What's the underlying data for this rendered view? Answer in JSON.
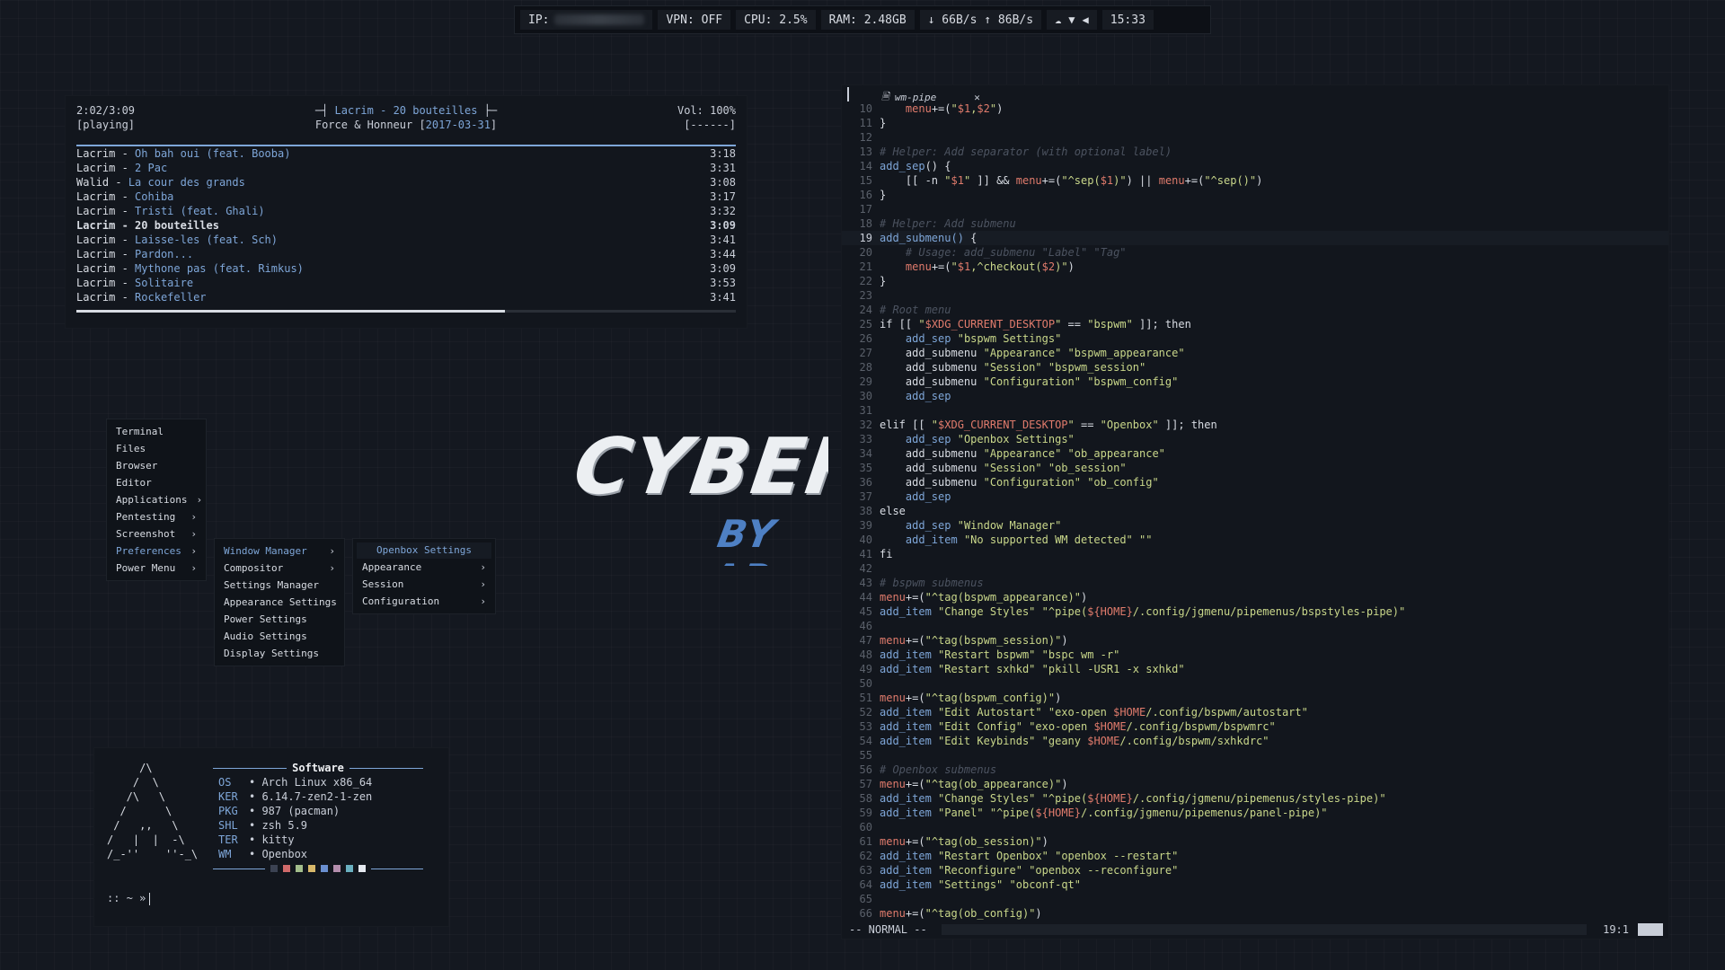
{
  "topbar": {
    "ip_label": "IP:",
    "vpn": "VPN: OFF",
    "cpu": "CPU: 2.5%",
    "ram": "RAM: 2.48GB",
    "net": "↓ 66B/s ↑ 86B/s",
    "clock": "15:33",
    "icons": [
      "cloud-icon",
      "wifi-icon",
      "volume-icon"
    ]
  },
  "music": {
    "elapsed": "2:02/3:09",
    "state": "[playing]",
    "now_artist": "Lacrim",
    "now_title": "20 bouteilles",
    "album": "Force & Honneur",
    "date": "2017-03-31",
    "volume": "Vol: 100%",
    "flags": "[------]",
    "progress": 0.65,
    "tracks": [
      {
        "artist": "Lacrim",
        "title": "Oh bah oui (feat. Booba)",
        "time": "3:18",
        "current": false
      },
      {
        "artist": "Lacrim",
        "title": "2 Pac",
        "time": "3:31",
        "current": false
      },
      {
        "artist": "Walid",
        "title": "La cour des grands",
        "time": "3:08",
        "current": false
      },
      {
        "artist": "Lacrim",
        "title": "Cohiba",
        "time": "3:17",
        "current": false
      },
      {
        "artist": "Lacrim",
        "title": "Tristi (feat. Ghali)",
        "time": "3:32",
        "current": false
      },
      {
        "artist": "Lacrim",
        "title": "20 bouteilles",
        "time": "3:09",
        "current": true
      },
      {
        "artist": "Lacrim",
        "title": "Laisse-les (feat. Sch)",
        "time": "3:41",
        "current": false
      },
      {
        "artist": "Lacrim",
        "title": "Pardon...",
        "time": "3:44",
        "current": false
      },
      {
        "artist": "Lacrim",
        "title": "Mythone pas (feat. Rimkus)",
        "time": "3:09",
        "current": false
      },
      {
        "artist": "Lacrim",
        "title": "Solitaire",
        "time": "3:53",
        "current": false
      },
      {
        "artist": "Lacrim",
        "title": "Rockefeller",
        "time": "3:41",
        "current": false
      }
    ]
  },
  "menu": {
    "root": [
      {
        "label": "Terminal",
        "sub": false,
        "selected": false
      },
      {
        "label": "Files",
        "sub": false,
        "selected": false
      },
      {
        "label": "Browser",
        "sub": false,
        "selected": false
      },
      {
        "label": "Editor",
        "sub": false,
        "selected": false
      },
      {
        "label": "Applications",
        "sub": true,
        "selected": false
      },
      {
        "label": "Pentesting",
        "sub": true,
        "selected": false
      },
      {
        "label": "Screenshot",
        "sub": true,
        "selected": false
      },
      {
        "label": "Preferences",
        "sub": true,
        "selected": true
      },
      {
        "label": "Power Menu",
        "sub": true,
        "selected": false
      }
    ],
    "prefs": [
      {
        "label": "Window Manager",
        "sub": true,
        "selected": true
      },
      {
        "label": "Compositor",
        "sub": true,
        "selected": false
      },
      {
        "label": "Settings Manager",
        "sub": false,
        "selected": false
      },
      {
        "label": "Appearance Settings",
        "sub": false,
        "selected": false
      },
      {
        "label": "Power Settings",
        "sub": false,
        "selected": false
      },
      {
        "label": "Audio Settings",
        "sub": false,
        "selected": false
      },
      {
        "label": "Display Settings",
        "sub": false,
        "selected": false
      }
    ],
    "wm_title": "Openbox Settings",
    "wm": [
      {
        "label": "Appearance",
        "sub": true,
        "selected": false
      },
      {
        "label": "Session",
        "sub": true,
        "selected": false
      },
      {
        "label": "Configuration",
        "sub": true,
        "selected": false
      }
    ]
  },
  "logo": {
    "line1": "CYBERS",
    "line2": "BY AR"
  },
  "fetch": {
    "ascii": "     /\\\n    /  \\\n   /\\   \\\n  /      \\\n /   ,,   \\\n/   |  |  -\\\n/_-''    ''-_\\",
    "title": "Software",
    "rows": [
      {
        "key": "OS",
        "value": "Arch Linux x86_64"
      },
      {
        "key": "KER",
        "value": "6.14.7-zen2-1-zen"
      },
      {
        "key": "PKG",
        "value": "987 (pacman)"
      },
      {
        "key": "SHL",
        "value": "zsh 5.9"
      },
      {
        "key": "TER",
        "value": "kitty"
      },
      {
        "key": "WM",
        "value": "Openbox"
      }
    ],
    "swatches": [
      "#3b4252",
      "#d06a6a",
      "#a3be8c",
      "#d8b86a",
      "#6a8fd0",
      "#b48ead",
      "#6ab0c0",
      "#e5e9f0"
    ],
    "prompt": ":: ~ »"
  },
  "editor": {
    "tab": "wm-pipe",
    "mode": "-- NORMAL --",
    "position": "19:1",
    "active_line": 19,
    "lines": [
      {
        "n": 10,
        "t": "    menu+=(\"$1,$2\")"
      },
      {
        "n": 11,
        "t": "}"
      },
      {
        "n": 12,
        "t": ""
      },
      {
        "n": 13,
        "t": "# Helper: Add separator (with optional label)"
      },
      {
        "n": 14,
        "t": "add_sep() {"
      },
      {
        "n": 15,
        "t": "    [[ -n \"$1\" ]] && menu+=(\"^sep($1)\") || menu+=(\"^sep()\")"
      },
      {
        "n": 16,
        "t": "}"
      },
      {
        "n": 17,
        "t": ""
      },
      {
        "n": 18,
        "t": "# Helper: Add submenu"
      },
      {
        "n": 19,
        "t": "add_submenu() {"
      },
      {
        "n": 20,
        "t": "    # Usage: add_submenu \"Label\" \"Tag\""
      },
      {
        "n": 21,
        "t": "    menu+=(\"$1,^checkout($2)\")"
      },
      {
        "n": 22,
        "t": "}"
      },
      {
        "n": 23,
        "t": ""
      },
      {
        "n": 24,
        "t": "# Root menu"
      },
      {
        "n": 25,
        "t": "if [[ \"$XDG_CURRENT_DESKTOP\" == \"bspwm\" ]]; then"
      },
      {
        "n": 26,
        "t": "    add_sep \"bspwm Settings\""
      },
      {
        "n": 27,
        "t": "    add_submenu \"Appearance\" \"bspwm_appearance\""
      },
      {
        "n": 28,
        "t": "    add_submenu \"Session\" \"bspwm_session\""
      },
      {
        "n": 29,
        "t": "    add_submenu \"Configuration\" \"bspwm_config\""
      },
      {
        "n": 30,
        "t": "    add_sep"
      },
      {
        "n": 31,
        "t": ""
      },
      {
        "n": 32,
        "t": "elif [[ \"$XDG_CURRENT_DESKTOP\" == \"Openbox\" ]]; then"
      },
      {
        "n": 33,
        "t": "    add_sep \"Openbox Settings\""
      },
      {
        "n": 34,
        "t": "    add_submenu \"Appearance\" \"ob_appearance\""
      },
      {
        "n": 35,
        "t": "    add_submenu \"Session\" \"ob_session\""
      },
      {
        "n": 36,
        "t": "    add_submenu \"Configuration\" \"ob_config\""
      },
      {
        "n": 37,
        "t": "    add_sep"
      },
      {
        "n": 38,
        "t": "else"
      },
      {
        "n": 39,
        "t": "    add_sep \"Window Manager\""
      },
      {
        "n": 40,
        "t": "    add_item \"No supported WM detected\" \"\""
      },
      {
        "n": 41,
        "t": "fi"
      },
      {
        "n": 42,
        "t": ""
      },
      {
        "n": 43,
        "t": "# bspwm submenus"
      },
      {
        "n": 44,
        "t": "menu+=(\"^tag(bspwm_appearance)\")"
      },
      {
        "n": 45,
        "t": "add_item \"Change Styles\" \"^pipe(${HOME}/.config/jgmenu/pipemenus/bspstyles-pipe)\""
      },
      {
        "n": 46,
        "t": ""
      },
      {
        "n": 47,
        "t": "menu+=(\"^tag(bspwm_session)\")"
      },
      {
        "n": 48,
        "t": "add_item \"Restart bspwm\" \"bspc wm -r\""
      },
      {
        "n": 49,
        "t": "add_item \"Restart sxhkd\" \"pkill -USR1 -x sxhkd\""
      },
      {
        "n": 50,
        "t": ""
      },
      {
        "n": 51,
        "t": "menu+=(\"^tag(bspwm_config)\")"
      },
      {
        "n": 52,
        "t": "add_item \"Edit Autostart\" \"exo-open $HOME/.config/bspwm/autostart\""
      },
      {
        "n": 53,
        "t": "add_item \"Edit Config\" \"exo-open $HOME/.config/bspwm/bspwmrc\""
      },
      {
        "n": 54,
        "t": "add_item \"Edit Keybinds\" \"geany $HOME/.config/bspwm/sxhkdrc\""
      },
      {
        "n": 55,
        "t": ""
      },
      {
        "n": 56,
        "t": "# Openbox submenus"
      },
      {
        "n": 57,
        "t": "menu+=(\"^tag(ob_appearance)\")"
      },
      {
        "n": 58,
        "t": "add_item \"Change Styles\" \"^pipe(${HOME}/.config/jgmenu/pipemenus/styles-pipe)\""
      },
      {
        "n": 59,
        "t": "add_item \"Panel\" \"^pipe(${HOME}/.config/jgmenu/pipemenus/panel-pipe)\""
      },
      {
        "n": 60,
        "t": ""
      },
      {
        "n": 61,
        "t": "menu+=(\"^tag(ob_session)\")"
      },
      {
        "n": 62,
        "t": "add_item \"Restart Openbox\" \"openbox --restart\""
      },
      {
        "n": 63,
        "t": "add_item \"Reconfigure\" \"openbox --reconfigure\""
      },
      {
        "n": 64,
        "t": "add_item \"Settings\" \"obconf-qt\""
      },
      {
        "n": 65,
        "t": ""
      },
      {
        "n": 66,
        "t": "menu+=(\"^tag(ob_config)\")"
      }
    ]
  }
}
